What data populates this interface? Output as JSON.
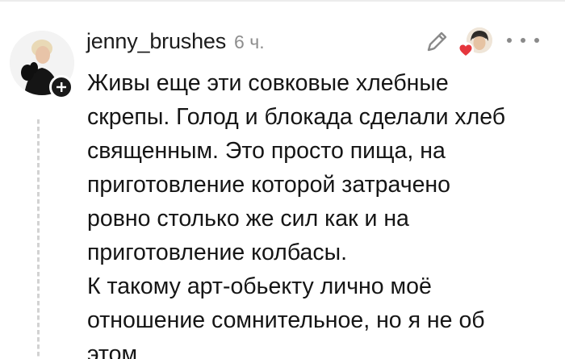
{
  "comment": {
    "username": "jenny_brushes",
    "timestamp": "6 ч.",
    "text": "Живы еще эти совковые хлебные\nскрепы. Голод и блокада сделали хлеб\nсвященным. Это просто пища, на\nприготовление которой затрачено\nровно столько же сил как и на\nприготовление колбасы.\nК такому арт-обьекту лично моё\nотношение сомнительное, но я не об\nэтом"
  },
  "icons": {
    "edit": "pencil-icon",
    "more": "more-dots-icon",
    "add": "plus-icon",
    "liked": "heart-icon"
  },
  "colors": {
    "text": "#151515",
    "muted": "#8d8d8d",
    "heart": "#e5363d",
    "badge": "#1a1a1a"
  }
}
